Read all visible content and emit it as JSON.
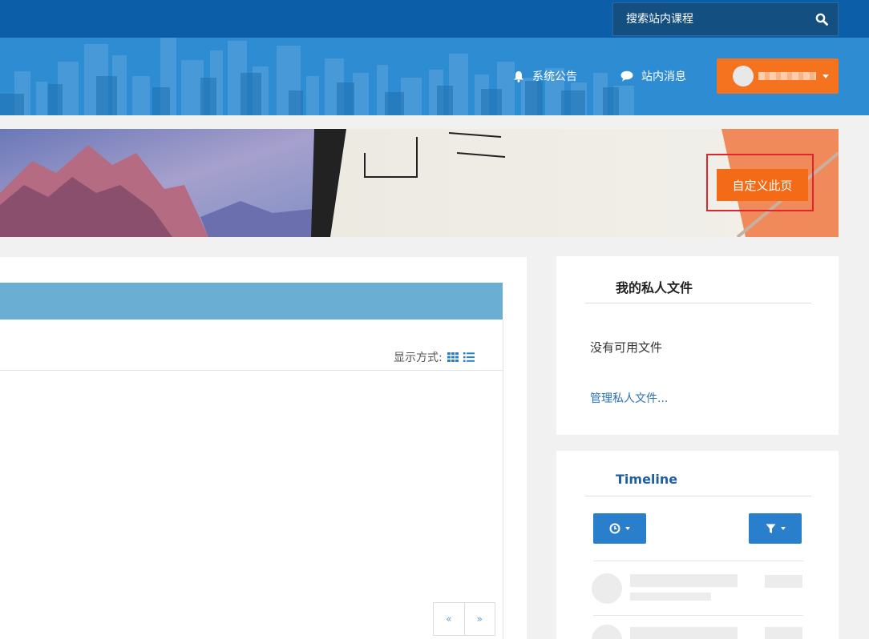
{
  "header": {
    "search": {
      "placeholder": "搜索站内课程"
    },
    "nav": {
      "announcements": "系统公告",
      "messages": "站内消息"
    }
  },
  "banner": {
    "customize_button": "自定义此页"
  },
  "main": {
    "display_label": "显示方式:"
  },
  "private_files": {
    "title": "我的私人文件",
    "empty_text": "没有可用文件",
    "manage_link": "管理私人文件..."
  },
  "timeline": {
    "title": "Timeline"
  },
  "pager": {
    "prev": "«",
    "next": "»"
  },
  "colors": {
    "topbar": "#0d5ea8",
    "nav": "#2e8cd2",
    "accent_orange": "#f36b17",
    "panel_header": "#6aaed3",
    "link": "#2a72b5"
  }
}
